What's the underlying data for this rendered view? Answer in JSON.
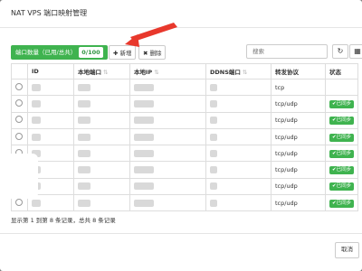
{
  "dialog": {
    "title": "NAT VPS 端口映射管理"
  },
  "toolbar": {
    "quota_label": "端口数量（已用/总共）",
    "quota_value": "0/100",
    "add_label": "新增",
    "delete_label": "删除",
    "search_placeholder": "搜索"
  },
  "table": {
    "headers": [
      "ID",
      "本地端口",
      "本地IP",
      "DDNS端口",
      "转发协议",
      "状态"
    ],
    "rows": [
      {
        "protocol": "tcp",
        "status": ""
      },
      {
        "protocol": "tcp/udp",
        "status": "已同步"
      },
      {
        "protocol": "tcp/udp",
        "status": "已同步"
      },
      {
        "protocol": "tcp/udp",
        "status": "已同步"
      },
      {
        "protocol": "tcp/udp",
        "status": "已同步"
      },
      {
        "protocol": "tcp/udp",
        "status": "已同步"
      },
      {
        "protocol": "tcp/udp",
        "status": "已同步"
      },
      {
        "protocol": "tcp/udp",
        "status": "已同步"
      }
    ]
  },
  "footer": {
    "summary": "显示第 1 到第 8 条记录，总共 8 条记录",
    "cancel_label": "取消"
  },
  "colors": {
    "accent_green": "#3fb34f",
    "arrow_red": "#e8382c"
  }
}
